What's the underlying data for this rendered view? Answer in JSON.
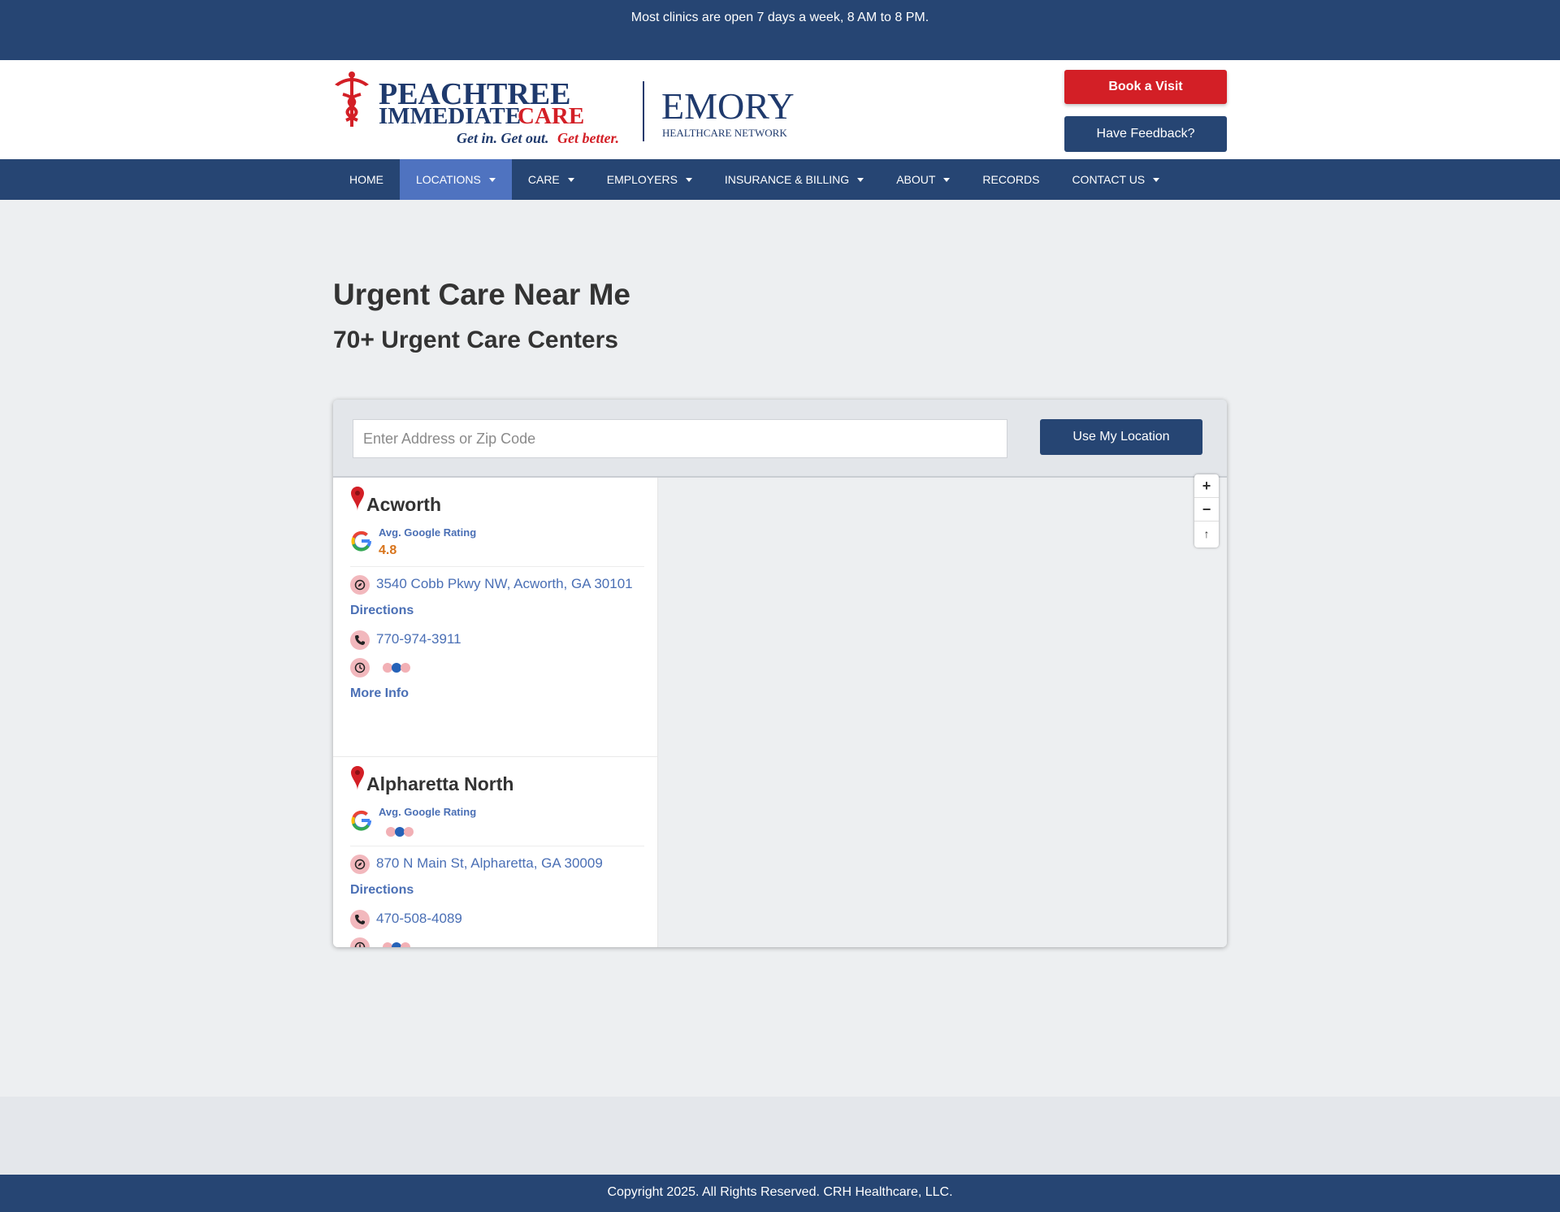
{
  "topbar": {
    "message": "Most clinics are open 7 days a week, 8 AM to 8 PM."
  },
  "logo": {
    "line1": "PEACHTREE",
    "line2a": "IMMEDIATE",
    "line2b": "CARE",
    "tagline_a": "Get in. Get out.",
    "tagline_b": "Get better.",
    "partner": "EMORY",
    "partner_sub": "HEALTHCARE NETWORK"
  },
  "header": {
    "book_label": "Book a Visit",
    "feedback_label": "Have Feedback?"
  },
  "nav": {
    "items": [
      {
        "label": "HOME",
        "dropdown": false
      },
      {
        "label": "LOCATIONS",
        "dropdown": true,
        "active": true
      },
      {
        "label": "CARE",
        "dropdown": true
      },
      {
        "label": "EMPLOYERS",
        "dropdown": true
      },
      {
        "label": "INSURANCE & BILLING",
        "dropdown": true
      },
      {
        "label": "ABOUT",
        "dropdown": true
      },
      {
        "label": "RECORDS",
        "dropdown": false
      },
      {
        "label": "CONTACT US",
        "dropdown": true
      }
    ]
  },
  "page": {
    "title": "Urgent Care Near Me",
    "subtitle": "70+ Urgent Care Centers"
  },
  "search": {
    "placeholder": "Enter Address or Zip Code",
    "value": "",
    "use_location_label": "Use My Location"
  },
  "locations": [
    {
      "name": "Acworth",
      "rating_label": "Avg. Google Rating",
      "rating": "4.8",
      "address": "3540 Cobb Pkwy NW, Acworth, GA 30101",
      "directions_label": "Directions",
      "phone": "770-974-3911",
      "more_info_label": "More Info"
    },
    {
      "name": "Alpharetta North",
      "rating_label": "Avg. Google Rating",
      "rating": "",
      "address": "870 N Main St, Alpharetta, GA 30009",
      "directions_label": "Directions",
      "phone": "470-508-4089"
    }
  ],
  "map": {
    "zoom_in": "+",
    "zoom_out": "−",
    "reset_north": "↑"
  },
  "footer": {
    "copyright": "Copyright 2025. All Rights Reserved. CRH Healthcare, LLC."
  },
  "colors": {
    "navy": "#264573",
    "red": "#d31f26",
    "link": "#4a6fb5",
    "rating": "#d8741b",
    "nav_active": "#4f73c0"
  }
}
